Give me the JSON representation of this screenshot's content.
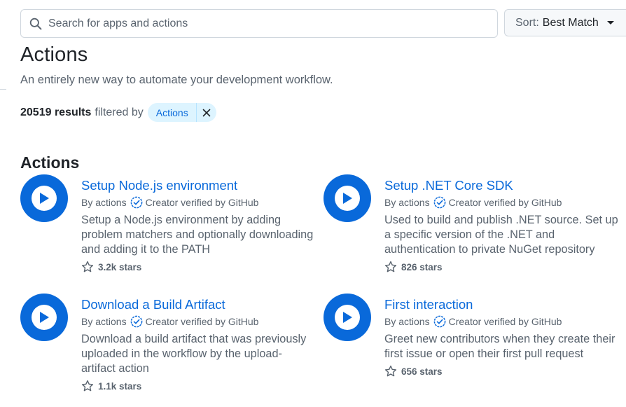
{
  "search": {
    "placeholder": "Search for apps and actions",
    "value": ""
  },
  "sort": {
    "prefix": "Sort:",
    "value": "Best Match"
  },
  "header": {
    "title": "Actions",
    "description": "An entirely new way to automate your development workflow."
  },
  "results": {
    "count": "20519 results",
    "filtered_by": "filtered by",
    "filter_chip": "Actions"
  },
  "section": {
    "title": "Actions"
  },
  "colors": {
    "accent": "#0969da",
    "chip_bg": "#ddf4ff",
    "text_muted": "#59636e"
  },
  "cards": [
    {
      "name": "Setup Node.js environment",
      "by": "By actions",
      "verified": "Creator verified by GitHub",
      "description": "Setup a Node.js environment by adding problem matchers and optionally downloading and adding it to the PATH",
      "stars": "3.2k stars"
    },
    {
      "name": "Setup .NET Core SDK",
      "by": "By actions",
      "verified": "Creator verified by GitHub",
      "description": "Used to build and publish .NET source. Set up a specific version of the .NET and authentication to private NuGet repository",
      "stars": "826 stars"
    },
    {
      "name": "Download a Build Artifact",
      "by": "By actions",
      "verified": "Creator verified by GitHub",
      "description": "Download a build artifact that was previously uploaded in the workflow by the upload-artifact action",
      "stars": "1.1k stars"
    },
    {
      "name": "First interaction",
      "by": "By actions",
      "verified": "Creator verified by GitHub",
      "description": "Greet new contributors when they create their first issue or open their first pull request",
      "stars": "656 stars"
    }
  ]
}
